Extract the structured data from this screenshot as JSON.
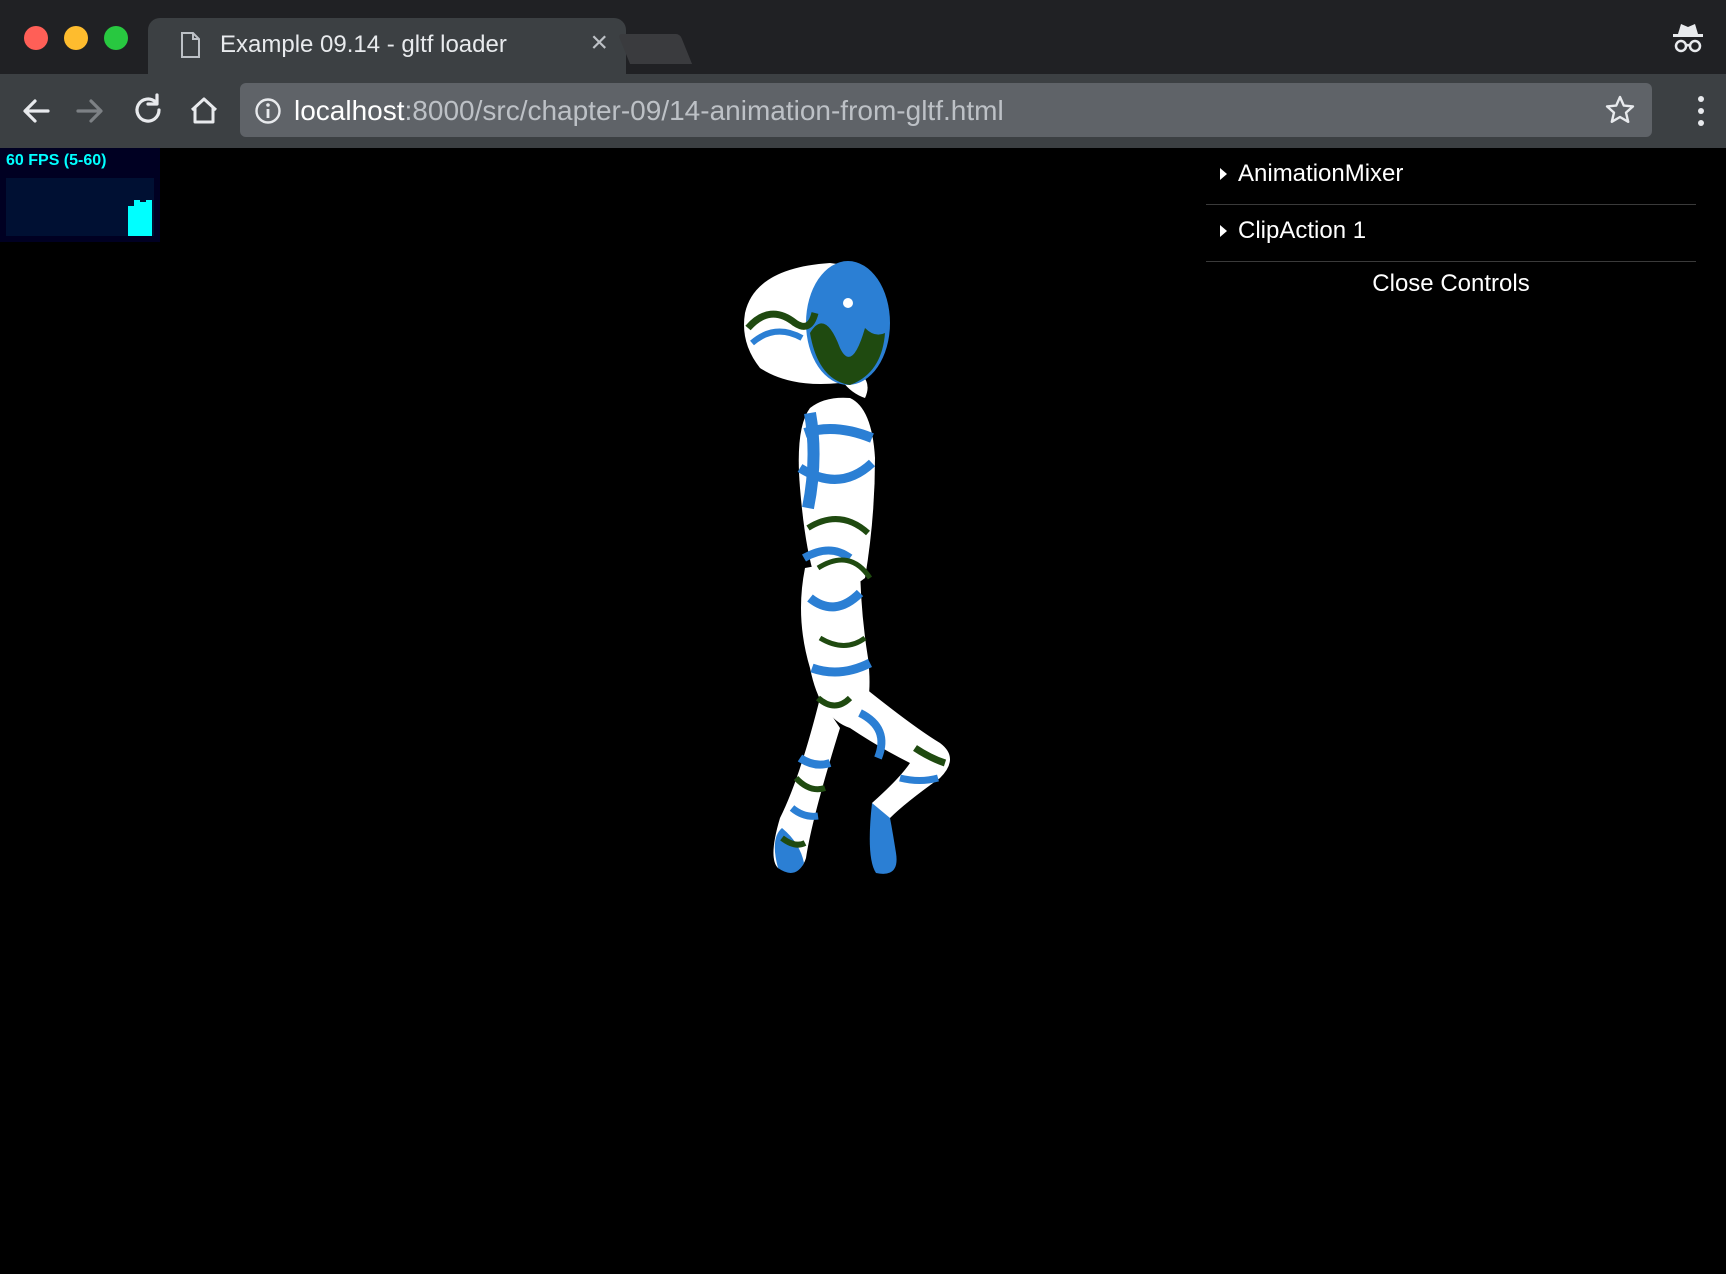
{
  "browser": {
    "tab": {
      "title": "Example 09.14 - gltf loader",
      "close_glyph": "×"
    },
    "address": {
      "host": "localhost",
      "path": ":8000/src/chapter-09/14-animation-from-gltf.html"
    },
    "icons": {
      "back": "back-arrow-icon",
      "forward": "forward-arrow-icon",
      "reload": "reload-icon",
      "home": "home-icon",
      "info": "info-icon",
      "bookmark": "star-icon",
      "menu": "three-dots-menu-icon",
      "profile": "incognito-icon"
    },
    "colors": {
      "frame": "#202124",
      "tab": "#3c4043",
      "omnibox": "#5f6368"
    }
  },
  "stats": {
    "text": "60 FPS (5-60)",
    "color": "#00ffff",
    "background": "#000022"
  },
  "gui": {
    "folders": [
      {
        "label": "AnimationMixer"
      },
      {
        "label": "ClipAction 1"
      }
    ],
    "close_label": "Close Controls"
  },
  "scene": {
    "background": "#000000",
    "model_colors": {
      "base": "#ffffff",
      "blue": "#2b7fd4",
      "green": "#1f4a10"
    }
  }
}
